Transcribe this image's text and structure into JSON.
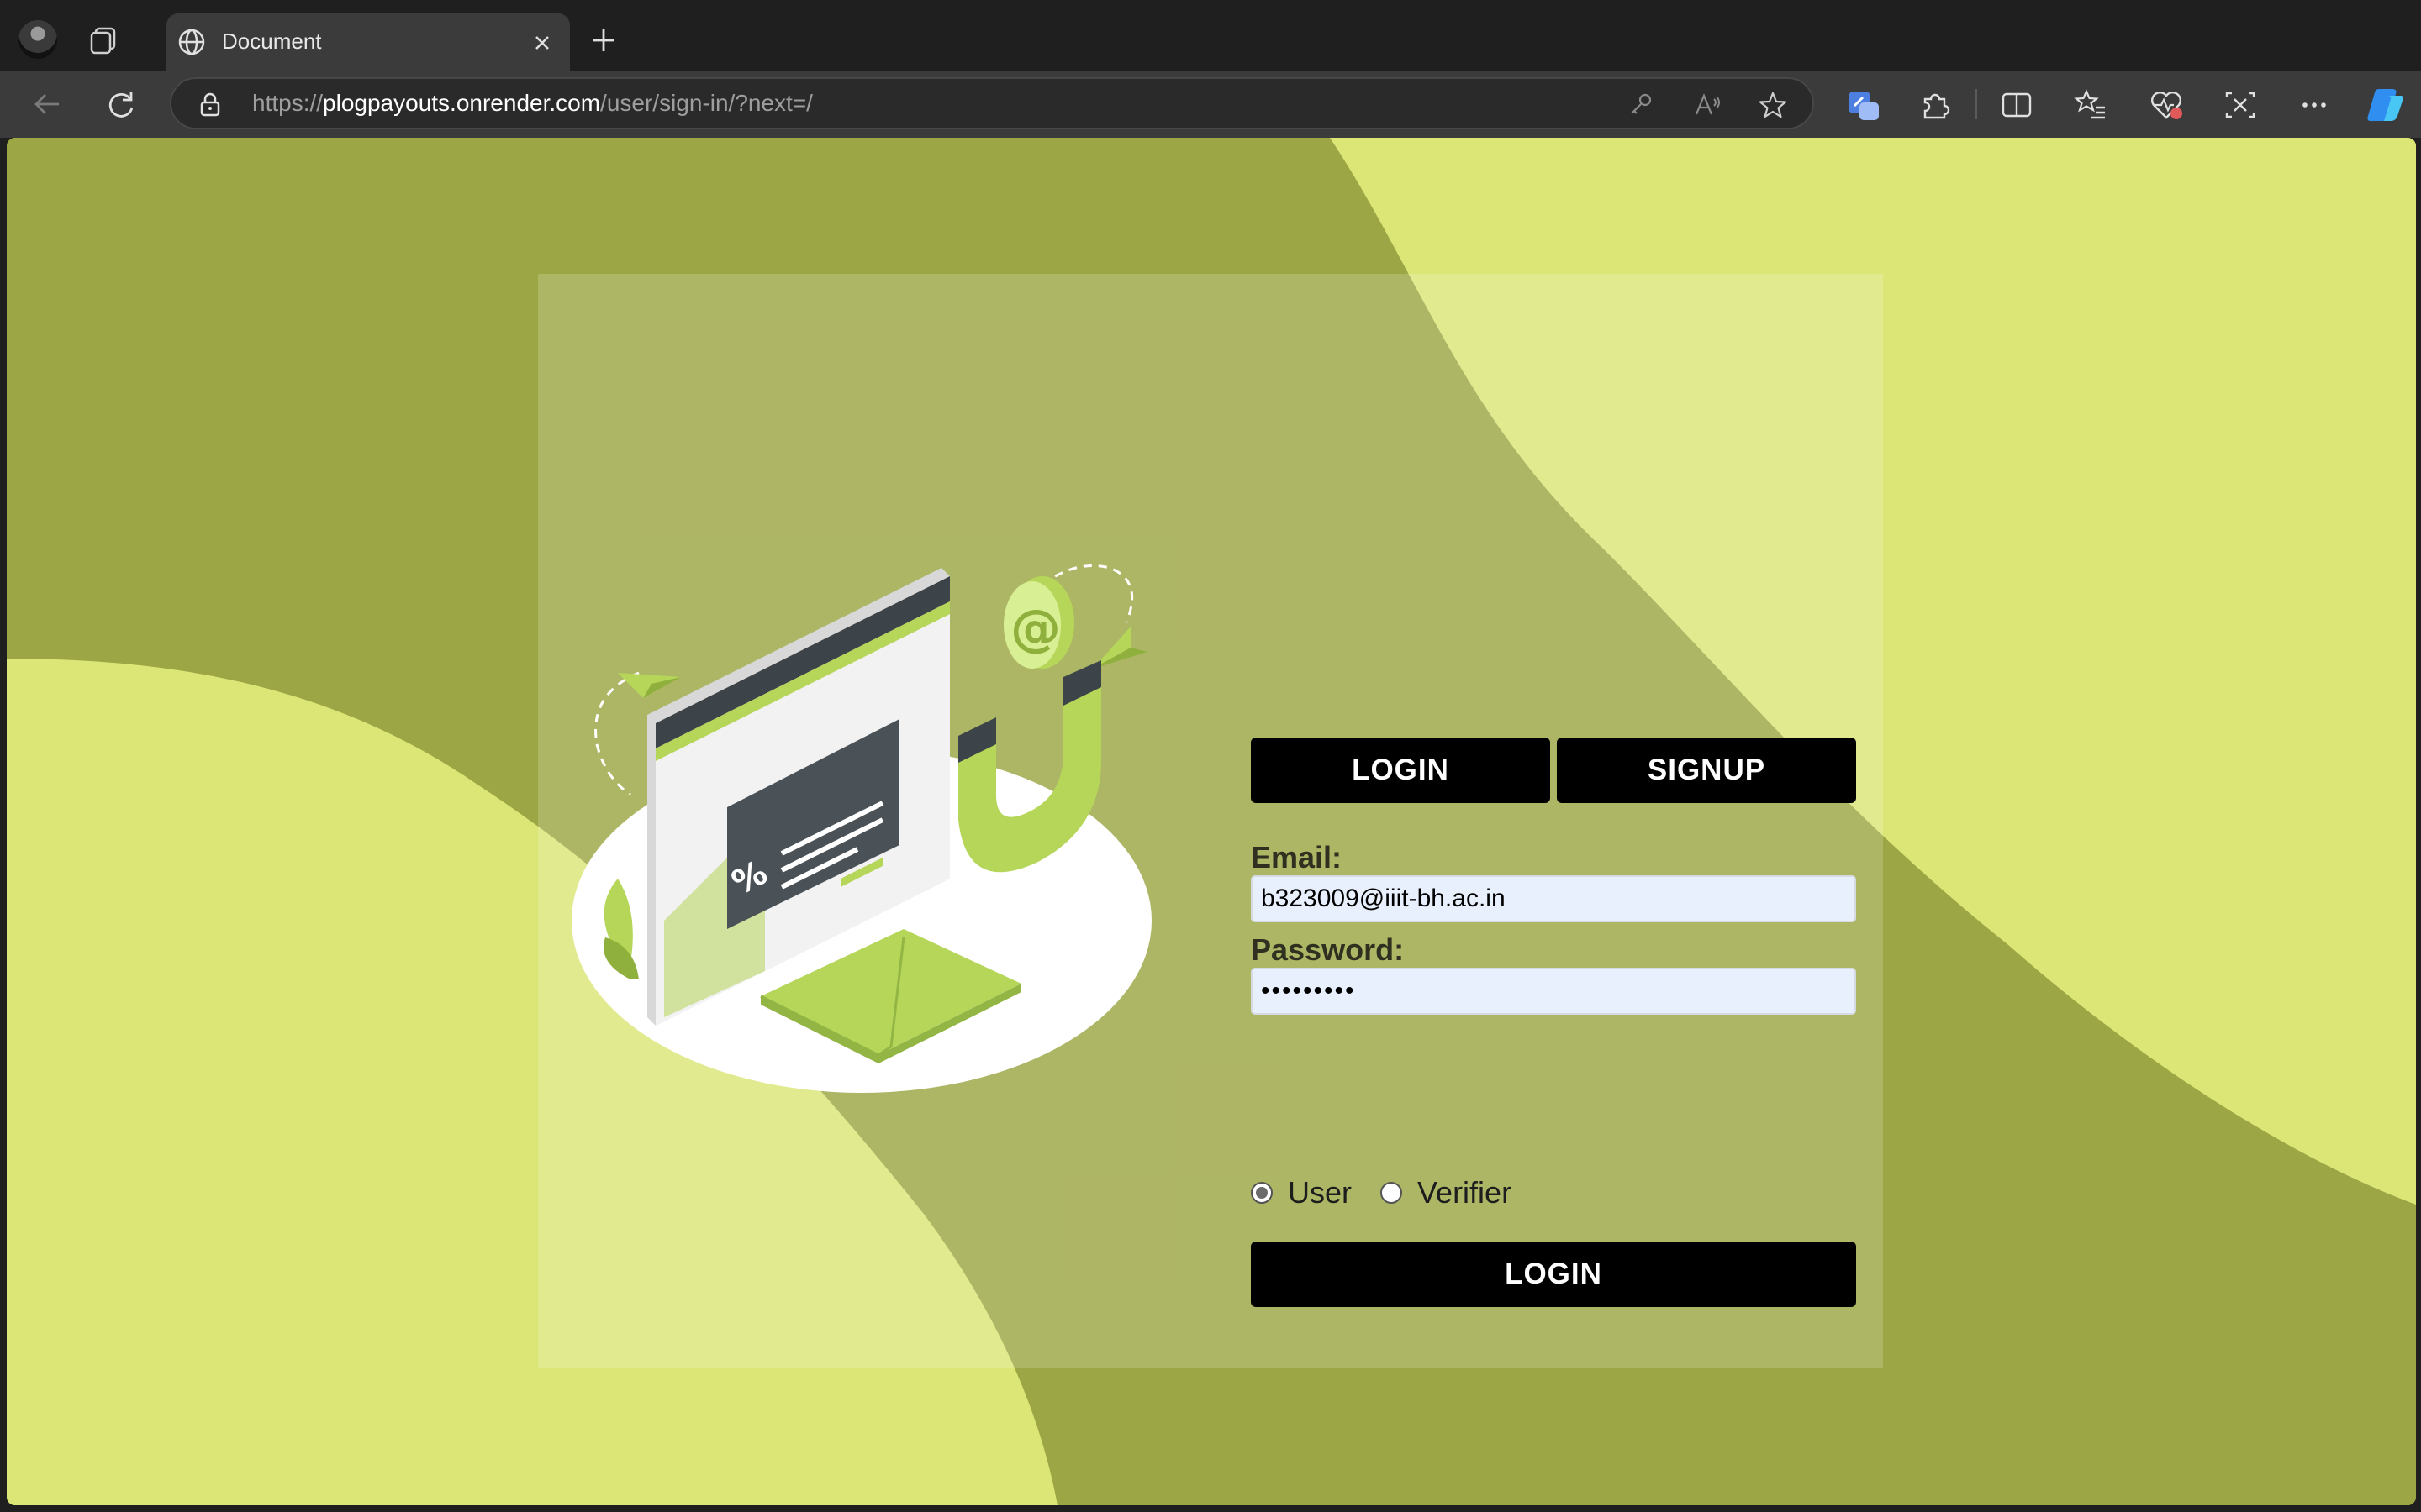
{
  "browser": {
    "tab": {
      "title": "Document"
    },
    "address": {
      "scheme": "https://",
      "host": "plogpayouts.onrender.com",
      "path": "/user/sign-in/?next=/"
    },
    "icons": [
      "profile-icon",
      "tab-actions-icon",
      "globe-icon",
      "close-icon",
      "plus-icon",
      "back-icon",
      "refresh-icon",
      "lock-icon",
      "key-icon",
      "read-aloud-icon",
      "favorite-star-icon",
      "extension-icon",
      "puzzle-icon",
      "split-screen-icon",
      "favorites-icon",
      "health-icon",
      "screenshot-icon",
      "more-icon",
      "copilot-icon"
    ]
  },
  "page": {
    "tabs": {
      "login": "LOGIN",
      "signup": "SIGNUP"
    },
    "form": {
      "email_label": "Email:",
      "email_value": "b323009@iiit-bh.ac.in",
      "password_label": "Password:",
      "password_value": "•••••••••",
      "roles": [
        {
          "label": "User",
          "checked": true
        },
        {
          "label": "Verifier",
          "checked": false
        }
      ],
      "submit_label": "LOGIN"
    },
    "colors": {
      "dark_olive": "#9ca644",
      "light_lime": "#dce677",
      "button": "#000000",
      "input_bg": "#e8effd"
    }
  }
}
